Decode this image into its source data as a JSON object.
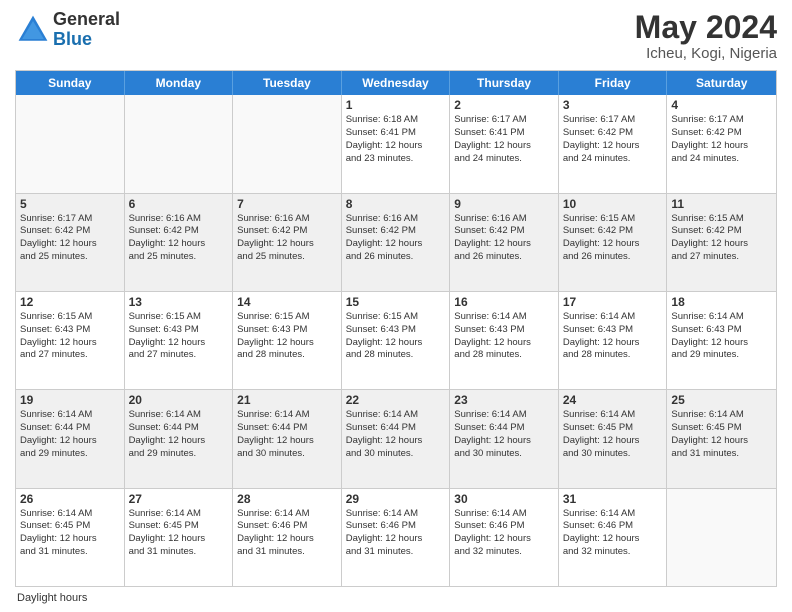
{
  "logo": {
    "general": "General",
    "blue": "Blue"
  },
  "title": {
    "month_year": "May 2024",
    "location": "Icheu, Kogi, Nigeria"
  },
  "header_days": [
    "Sunday",
    "Monday",
    "Tuesday",
    "Wednesday",
    "Thursday",
    "Friday",
    "Saturday"
  ],
  "weeks": [
    {
      "cells": [
        {
          "day": "",
          "lines": [],
          "empty": true
        },
        {
          "day": "",
          "lines": [],
          "empty": true
        },
        {
          "day": "",
          "lines": [],
          "empty": true
        },
        {
          "day": "1",
          "lines": [
            "Sunrise: 6:18 AM",
            "Sunset: 6:41 PM",
            "Daylight: 12 hours",
            "and 23 minutes."
          ],
          "empty": false
        },
        {
          "day": "2",
          "lines": [
            "Sunrise: 6:17 AM",
            "Sunset: 6:41 PM",
            "Daylight: 12 hours",
            "and 24 minutes."
          ],
          "empty": false
        },
        {
          "day": "3",
          "lines": [
            "Sunrise: 6:17 AM",
            "Sunset: 6:42 PM",
            "Daylight: 12 hours",
            "and 24 minutes."
          ],
          "empty": false
        },
        {
          "day": "4",
          "lines": [
            "Sunrise: 6:17 AM",
            "Sunset: 6:42 PM",
            "Daylight: 12 hours",
            "and 24 minutes."
          ],
          "empty": false
        }
      ]
    },
    {
      "cells": [
        {
          "day": "5",
          "lines": [
            "Sunrise: 6:17 AM",
            "Sunset: 6:42 PM",
            "Daylight: 12 hours",
            "and 25 minutes."
          ],
          "empty": false
        },
        {
          "day": "6",
          "lines": [
            "Sunrise: 6:16 AM",
            "Sunset: 6:42 PM",
            "Daylight: 12 hours",
            "and 25 minutes."
          ],
          "empty": false
        },
        {
          "day": "7",
          "lines": [
            "Sunrise: 6:16 AM",
            "Sunset: 6:42 PM",
            "Daylight: 12 hours",
            "and 25 minutes."
          ],
          "empty": false
        },
        {
          "day": "8",
          "lines": [
            "Sunrise: 6:16 AM",
            "Sunset: 6:42 PM",
            "Daylight: 12 hours",
            "and 26 minutes."
          ],
          "empty": false
        },
        {
          "day": "9",
          "lines": [
            "Sunrise: 6:16 AM",
            "Sunset: 6:42 PM",
            "Daylight: 12 hours",
            "and 26 minutes."
          ],
          "empty": false
        },
        {
          "day": "10",
          "lines": [
            "Sunrise: 6:15 AM",
            "Sunset: 6:42 PM",
            "Daylight: 12 hours",
            "and 26 minutes."
          ],
          "empty": false
        },
        {
          "day": "11",
          "lines": [
            "Sunrise: 6:15 AM",
            "Sunset: 6:42 PM",
            "Daylight: 12 hours",
            "and 27 minutes."
          ],
          "empty": false
        }
      ]
    },
    {
      "cells": [
        {
          "day": "12",
          "lines": [
            "Sunrise: 6:15 AM",
            "Sunset: 6:43 PM",
            "Daylight: 12 hours",
            "and 27 minutes."
          ],
          "empty": false
        },
        {
          "day": "13",
          "lines": [
            "Sunrise: 6:15 AM",
            "Sunset: 6:43 PM",
            "Daylight: 12 hours",
            "and 27 minutes."
          ],
          "empty": false
        },
        {
          "day": "14",
          "lines": [
            "Sunrise: 6:15 AM",
            "Sunset: 6:43 PM",
            "Daylight: 12 hours",
            "and 28 minutes."
          ],
          "empty": false
        },
        {
          "day": "15",
          "lines": [
            "Sunrise: 6:15 AM",
            "Sunset: 6:43 PM",
            "Daylight: 12 hours",
            "and 28 minutes."
          ],
          "empty": false
        },
        {
          "day": "16",
          "lines": [
            "Sunrise: 6:14 AM",
            "Sunset: 6:43 PM",
            "Daylight: 12 hours",
            "and 28 minutes."
          ],
          "empty": false
        },
        {
          "day": "17",
          "lines": [
            "Sunrise: 6:14 AM",
            "Sunset: 6:43 PM",
            "Daylight: 12 hours",
            "and 28 minutes."
          ],
          "empty": false
        },
        {
          "day": "18",
          "lines": [
            "Sunrise: 6:14 AM",
            "Sunset: 6:43 PM",
            "Daylight: 12 hours",
            "and 29 minutes."
          ],
          "empty": false
        }
      ]
    },
    {
      "cells": [
        {
          "day": "19",
          "lines": [
            "Sunrise: 6:14 AM",
            "Sunset: 6:44 PM",
            "Daylight: 12 hours",
            "and 29 minutes."
          ],
          "empty": false
        },
        {
          "day": "20",
          "lines": [
            "Sunrise: 6:14 AM",
            "Sunset: 6:44 PM",
            "Daylight: 12 hours",
            "and 29 minutes."
          ],
          "empty": false
        },
        {
          "day": "21",
          "lines": [
            "Sunrise: 6:14 AM",
            "Sunset: 6:44 PM",
            "Daylight: 12 hours",
            "and 30 minutes."
          ],
          "empty": false
        },
        {
          "day": "22",
          "lines": [
            "Sunrise: 6:14 AM",
            "Sunset: 6:44 PM",
            "Daylight: 12 hours",
            "and 30 minutes."
          ],
          "empty": false
        },
        {
          "day": "23",
          "lines": [
            "Sunrise: 6:14 AM",
            "Sunset: 6:44 PM",
            "Daylight: 12 hours",
            "and 30 minutes."
          ],
          "empty": false
        },
        {
          "day": "24",
          "lines": [
            "Sunrise: 6:14 AM",
            "Sunset: 6:45 PM",
            "Daylight: 12 hours",
            "and 30 minutes."
          ],
          "empty": false
        },
        {
          "day": "25",
          "lines": [
            "Sunrise: 6:14 AM",
            "Sunset: 6:45 PM",
            "Daylight: 12 hours",
            "and 31 minutes."
          ],
          "empty": false
        }
      ]
    },
    {
      "cells": [
        {
          "day": "26",
          "lines": [
            "Sunrise: 6:14 AM",
            "Sunset: 6:45 PM",
            "Daylight: 12 hours",
            "and 31 minutes."
          ],
          "empty": false
        },
        {
          "day": "27",
          "lines": [
            "Sunrise: 6:14 AM",
            "Sunset: 6:45 PM",
            "Daylight: 12 hours",
            "and 31 minutes."
          ],
          "empty": false
        },
        {
          "day": "28",
          "lines": [
            "Sunrise: 6:14 AM",
            "Sunset: 6:46 PM",
            "Daylight: 12 hours",
            "and 31 minutes."
          ],
          "empty": false
        },
        {
          "day": "29",
          "lines": [
            "Sunrise: 6:14 AM",
            "Sunset: 6:46 PM",
            "Daylight: 12 hours",
            "and 31 minutes."
          ],
          "empty": false
        },
        {
          "day": "30",
          "lines": [
            "Sunrise: 6:14 AM",
            "Sunset: 6:46 PM",
            "Daylight: 12 hours",
            "and 32 minutes."
          ],
          "empty": false
        },
        {
          "day": "31",
          "lines": [
            "Sunrise: 6:14 AM",
            "Sunset: 6:46 PM",
            "Daylight: 12 hours",
            "and 32 minutes."
          ],
          "empty": false
        },
        {
          "day": "",
          "lines": [],
          "empty": true
        }
      ]
    }
  ],
  "footer": {
    "note": "Daylight hours"
  }
}
